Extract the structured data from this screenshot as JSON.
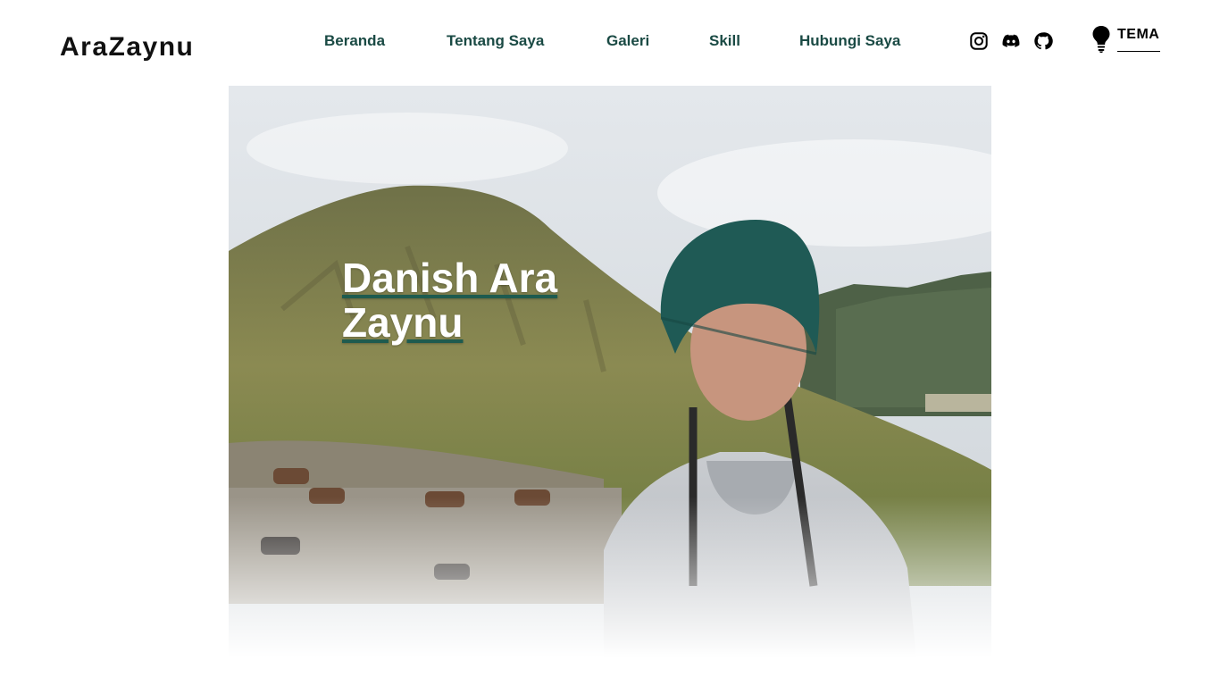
{
  "brand": {
    "name": "AraZaynu"
  },
  "nav": {
    "items": [
      {
        "label": "Beranda"
      },
      {
        "label": "Tentang Saya"
      },
      {
        "label": "Galeri"
      },
      {
        "label": "Skill"
      },
      {
        "label": "Hubungi Saya"
      }
    ]
  },
  "socials": [
    {
      "icon": "instagram-icon"
    },
    {
      "icon": "discord-icon"
    },
    {
      "icon": "github-icon"
    }
  ],
  "theme_toggle": {
    "label": "TEMA",
    "icon": "lightbulb-icon"
  },
  "hero": {
    "title_line1": "Danish Ara",
    "title_line2": "Zaynu",
    "accent_color": "#1e5b4f",
    "nav_color": "#1a4a44"
  }
}
